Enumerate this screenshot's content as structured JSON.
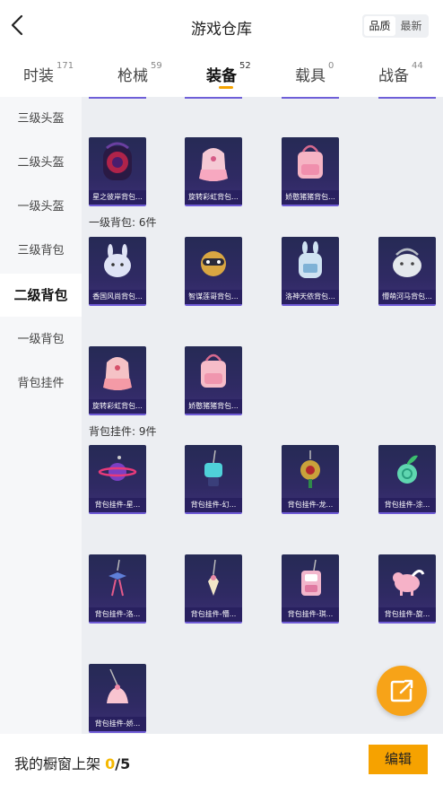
{
  "header": {
    "title": "游戏仓库",
    "sort_options": [
      "品质",
      "最新"
    ],
    "active_sort": "品质"
  },
  "tabs": [
    {
      "label": "时装",
      "count": "171"
    },
    {
      "label": "枪械",
      "count": "59"
    },
    {
      "label": "装备",
      "count": "52"
    },
    {
      "label": "载具",
      "count": "0"
    },
    {
      "label": "战备",
      "count": "44"
    }
  ],
  "active_tab": "装备",
  "sidebar": {
    "items": [
      {
        "label": "三级头盔"
      },
      {
        "label": "二级头盔"
      },
      {
        "label": "一级头盔"
      },
      {
        "label": "三级背包"
      },
      {
        "label": "二级背包"
      },
      {
        "label": "一级背包"
      },
      {
        "label": "背包挂件"
      }
    ],
    "active": "二级背包"
  },
  "sections": [
    {
      "label": "",
      "items": [
        {
          "name": "星之彼岸背包...",
          "icon": "backpack-icon"
        },
        {
          "name": "旋转彩虹背包...",
          "icon": "backpack-icon"
        },
        {
          "name": "娇憨猪猪背包...",
          "icon": "backpack-icon"
        }
      ]
    },
    {
      "label": "一级背包: 6件",
      "items": [
        {
          "name": "香国风尚背包...",
          "icon": "backpack-icon"
        },
        {
          "name": "智谋莲哥背包...",
          "icon": "backpack-icon"
        },
        {
          "name": "洛神天依背包...",
          "icon": "backpack-icon"
        },
        {
          "name": "懵萌河马背包...",
          "icon": "backpack-icon"
        },
        {
          "name": "旋转彩虹背包...",
          "icon": "backpack-icon"
        },
        {
          "name": "娇憨猪猪背包...",
          "icon": "backpack-icon"
        }
      ]
    },
    {
      "label": "背包挂件: 9件",
      "items": [
        {
          "name": "背包挂件-星...",
          "icon": "charm-icon"
        },
        {
          "name": "背包挂件-幻...",
          "icon": "charm-icon"
        },
        {
          "name": "背包挂件-龙...",
          "icon": "charm-icon"
        },
        {
          "name": "背包挂件-涂...",
          "icon": "charm-icon"
        },
        {
          "name": "背包挂件-洛...",
          "icon": "charm-icon"
        },
        {
          "name": "背包挂件-懵...",
          "icon": "charm-icon"
        },
        {
          "name": "背包挂件-琪...",
          "icon": "charm-icon"
        },
        {
          "name": "背包挂件-旋...",
          "icon": "charm-icon"
        },
        {
          "name": "背包挂件-娇...",
          "icon": "charm-icon"
        }
      ]
    }
  ],
  "fab": {
    "icon": "share-icon"
  },
  "bottom": {
    "label": "我的橱窗上架",
    "current": "0",
    "separator": "/",
    "total": "5",
    "edit_label": "编辑"
  },
  "colors": {
    "accent": "#f6a200",
    "card_bg": "#2f2a63",
    "card_border": "#6f5bd6",
    "highlight_count": "#f5b800"
  }
}
